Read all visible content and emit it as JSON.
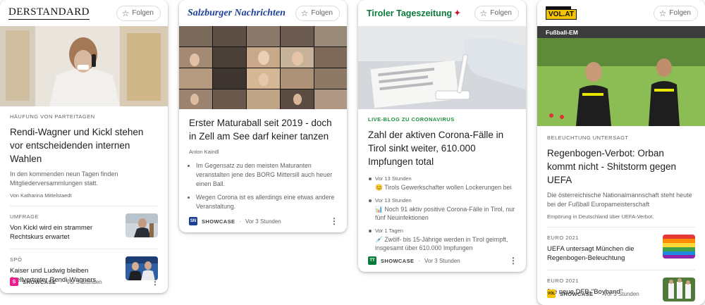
{
  "follow_label": "Folgen",
  "showcase_label": "SHOWCASE",
  "separator": "·",
  "cards": [
    {
      "publisher": "DERSTANDARD",
      "kicker": "HÄUFUNG VON PARTEITAGEN",
      "headline": "Rendi-Wagner und Kickl stehen vor entscheidenden internen Wahlen",
      "description": "In den kommenden neun Tagen finden Mitgliederversammlungen statt.",
      "author": "Von Katharina Mittelstaedt",
      "related": [
        {
          "kicker": "UMFRAGE",
          "title": "Von Kickl wird ein strammer Rechtskurs erwartet"
        },
        {
          "kicker": "SPÖ",
          "title": "Kaiser und Ludwig bleiben Stellvertreter Rendi-Wagners"
        }
      ],
      "favicon": "S",
      "time": "Vor 3 Stunden"
    },
    {
      "publisher": "Salzburger Nachrichten",
      "headline": "Erster Maturaball seit 2019 - doch in Zell am See darf keiner tanzen",
      "author": "Anton Kaindl",
      "bullets": [
        "Im Gegensatz zu den meisten Maturanten veranstalten jene des BORG Mittersill auch heuer einen Ball.",
        "Wegen Corona ist es allerdings eine etwas andere Veranstaltung."
      ],
      "favicon": "SN",
      "time": "Vor 3 Stunden"
    },
    {
      "publisher": "Tiroler Tageszeitung",
      "kicker": "LIVE-BLOG ZU CORONAVIRUS",
      "headline": "Zahl der aktiven Corona-Fälle in Tirol sinkt weiter, 610.000 Impfungen total",
      "timeline": [
        {
          "time": "Vor 13 Stunden",
          "text": "😊 Tirols Gewerkschafter wollen Lockerungen bei"
        },
        {
          "time": "Vor 13 Stunden",
          "text": "📊 Noch 91 aktiv positive Corona-Fälle in Tirol, nur fünf Neuinfektionen"
        },
        {
          "time": "Vor 1 Tagen",
          "text": "💉 Zwölf- bis 15-Jährige werden in Tirol geimpft, insgesamt über 610.000 Impfungen"
        }
      ],
      "favicon": "TT",
      "time": "Vor 3 Stunden"
    },
    {
      "publisher": "VOL.AT",
      "section": "Fußball-EM",
      "kicker": "BELEUCHTUNG UNTERSAGT",
      "headline": "Regenbogen-Verbot: Orban kommt nicht - Shitstorm gegen UEFA",
      "description": "Die österreichische Nationalmannschaft steht heute bei der Fußball Europameisterschaft",
      "author": "Empörung in Deutschland über UEFA-Verbot.",
      "related": [
        {
          "kicker": "EURO 2021",
          "title": "UEFA untersagt München die Regenbogen-Beleuchtung"
        },
        {
          "kicker": "EURO 2021",
          "title": "Die neue DFB-\"Boyband\""
        }
      ],
      "favicon": "VOL",
      "time": "Vor 3 Stunden"
    }
  ],
  "colors": {
    "standard_favicon": "#e91e8c",
    "sn_blue": "#1d3f95",
    "tt_green": "#0a7a3c",
    "vol_yellow": "#f5c400",
    "kicker_green": "#1e8e3e"
  }
}
